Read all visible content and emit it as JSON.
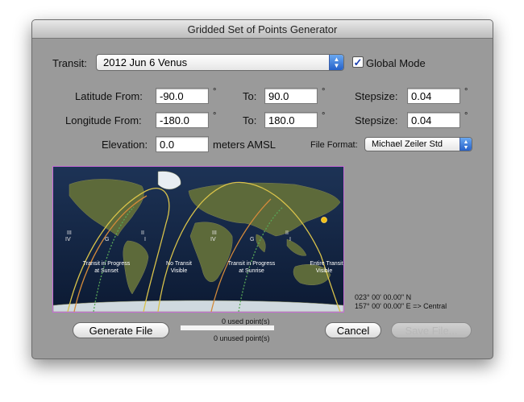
{
  "window": {
    "title": "Gridded Set of Points Generator"
  },
  "transit": {
    "label": "Transit:",
    "value": "2012 Jun 6 Venus"
  },
  "global_mode": {
    "label": "Global Mode",
    "checked": true
  },
  "latitude": {
    "label": "Latitude From:",
    "from": "-90.0",
    "to_label": "To:",
    "to": "90.0",
    "unit": "°",
    "step_label": "Stepsize:",
    "step": "0.04"
  },
  "longitude": {
    "label": "Longitude From:",
    "from": "-180.0",
    "to_label": "To:",
    "to": "180.0",
    "unit": "°",
    "step_label": "Stepsize:",
    "step": "0.04"
  },
  "elevation": {
    "label": "Elevation:",
    "value": "0.0",
    "unit": "meters AMSL"
  },
  "file_format": {
    "label": "File Format:",
    "value": "Michael Zeiler Std"
  },
  "map": {
    "labels": {
      "sunset": [
        "Transit in Progress",
        "at Sunset"
      ],
      "no_transit": [
        "No Transit",
        "Visible"
      ],
      "sunrise": [
        "Transit in Progress",
        "at Sunrise"
      ],
      "entire": [
        "Entire Transit",
        "Visible"
      ]
    },
    "contacts": [
      "III",
      "IV",
      "G",
      "II",
      "I",
      "III",
      "IV",
      "G",
      "II",
      "I"
    ]
  },
  "coordinates": {
    "lat": "023° 00' 00.00\" N",
    "lon": "157° 00' 00.00\" E => Central"
  },
  "buttons": {
    "generate": "Generate File",
    "cancel": "Cancel",
    "save": "Save File..."
  },
  "status": {
    "used": "0 used point(s)",
    "unused": "0 unused point(s)"
  },
  "progress": {
    "fraction": 0
  }
}
